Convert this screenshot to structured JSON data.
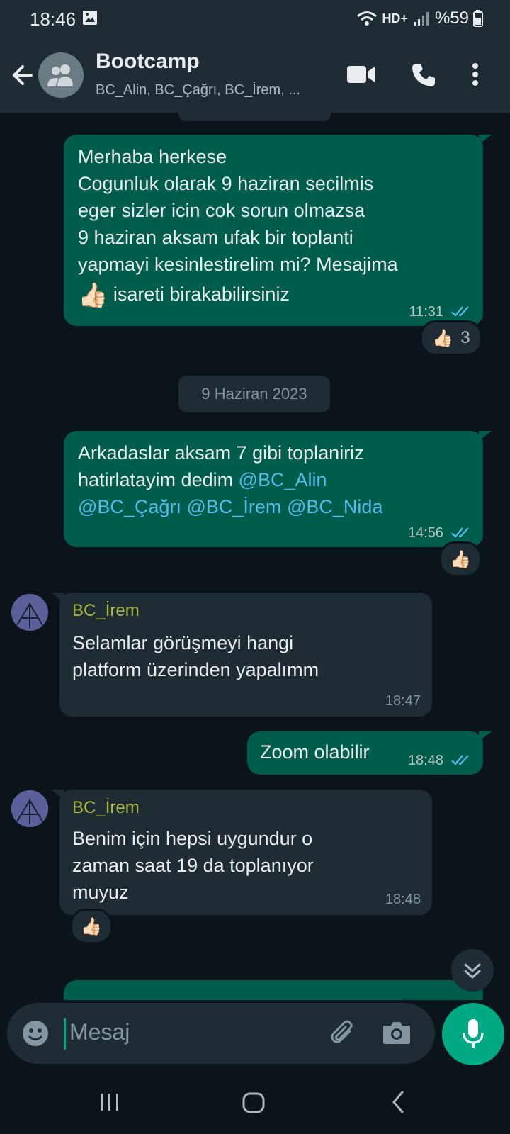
{
  "status_bar": {
    "time": "18:46",
    "network": "HD+",
    "battery": "%59"
  },
  "header": {
    "title": "Bootcamp",
    "subtitle": "BC_Alin, BC_Çağrı, BC_İrem, ..."
  },
  "messages": [
    {
      "direction": "out",
      "lines": [
        "Merhaba herkese",
        "Cogunluk olarak 9 haziran secilmis",
        "eger sizler icin cok sorun olmazsa",
        "9 haziran aksam ufak bir toplanti",
        "yapmayi kesinlestirelim mi? Mesajima"
      ],
      "last_line_emoji": "👍🏻",
      "last_line_text": "isareti birakabilirsiniz",
      "time": "11:31",
      "reaction": {
        "emoji": "👍🏻",
        "count": "3"
      }
    },
    {
      "type": "date",
      "text": "9 Haziran 2023"
    },
    {
      "direction": "out",
      "line1": "Arkadaslar aksam 7 gibi toplaniriz",
      "line2_text": "hatirlatayim dedim ",
      "mention1": "@BC_Alin",
      "mention2": "@BC_Çağrı",
      "mention3": "@BC_İrem",
      "mention4": "@BC_Nida",
      "time": "14:56",
      "reaction": {
        "emoji": "👍🏻"
      }
    },
    {
      "direction": "in",
      "sender": "BC_İrem",
      "text": "Selamlar görüşmeyi hangi\nplatform üzerinden yapalımm",
      "time": "18:47"
    },
    {
      "direction": "out",
      "text": "Zoom olabilir",
      "time": "18:48"
    },
    {
      "direction": "in",
      "sender": "BC_İrem",
      "text": "Benim için hepsi uygundur o\nzaman saat 19 da toplanıyor\nmuyuz",
      "time": "18:48",
      "reaction": {
        "emoji": "👍🏻"
      }
    }
  ],
  "composer": {
    "placeholder": "Mesaj"
  },
  "colors": {
    "outgoing_bubble": "#005c4b",
    "incoming_bubble": "#1f2c34",
    "background": "#0b141a",
    "accent": "#00a884",
    "mention": "#53bdeb",
    "sender_name": "#a8b842"
  }
}
